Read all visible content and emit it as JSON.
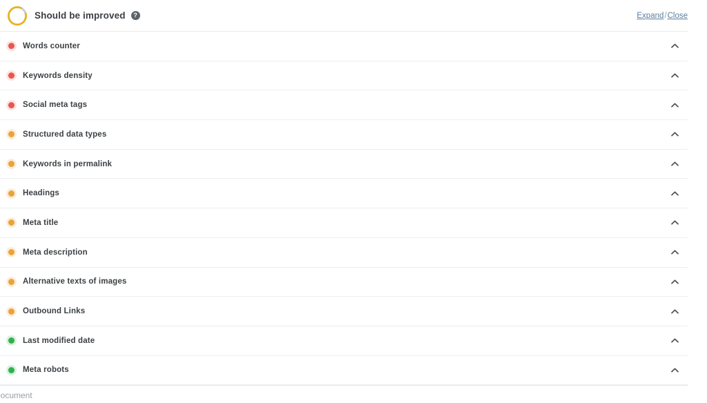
{
  "header": {
    "title": "Should be improved",
    "help_icon": "question-mark-circle-icon",
    "score_ring": {
      "icon": "progress-ring-icon",
      "color": "#e8b422",
      "track_color": "#c9cdd2"
    },
    "expand_label": "Expand",
    "separator": "/",
    "close_label": "Close"
  },
  "status_colors": {
    "red": "#e8564f",
    "orange": "#e9a33c",
    "green": "#2fb24c"
  },
  "rows": [
    {
      "label": "Words counter",
      "status": "red",
      "chevron": "chevron-up-icon"
    },
    {
      "label": "Keywords density",
      "status": "red",
      "chevron": "chevron-up-icon"
    },
    {
      "label": "Social meta tags",
      "status": "red",
      "chevron": "chevron-up-icon"
    },
    {
      "label": "Structured data types",
      "status": "orange",
      "chevron": "chevron-up-icon"
    },
    {
      "label": "Keywords in permalink",
      "status": "orange",
      "chevron": "chevron-up-icon"
    },
    {
      "label": "Headings",
      "status": "orange",
      "chevron": "chevron-up-icon"
    },
    {
      "label": "Meta title",
      "status": "orange",
      "chevron": "chevron-up-icon"
    },
    {
      "label": "Meta description",
      "status": "orange",
      "chevron": "chevron-up-icon"
    },
    {
      "label": "Alternative texts of images",
      "status": "orange",
      "chevron": "chevron-up-icon"
    },
    {
      "label": "Outbound Links",
      "status": "orange",
      "chevron": "chevron-up-icon"
    },
    {
      "label": "Last modified date",
      "status": "green",
      "chevron": "chevron-up-icon"
    },
    {
      "label": "Meta robots",
      "status": "green",
      "chevron": "chevron-up-icon"
    }
  ],
  "footer": {
    "clipped_text": "Document"
  }
}
